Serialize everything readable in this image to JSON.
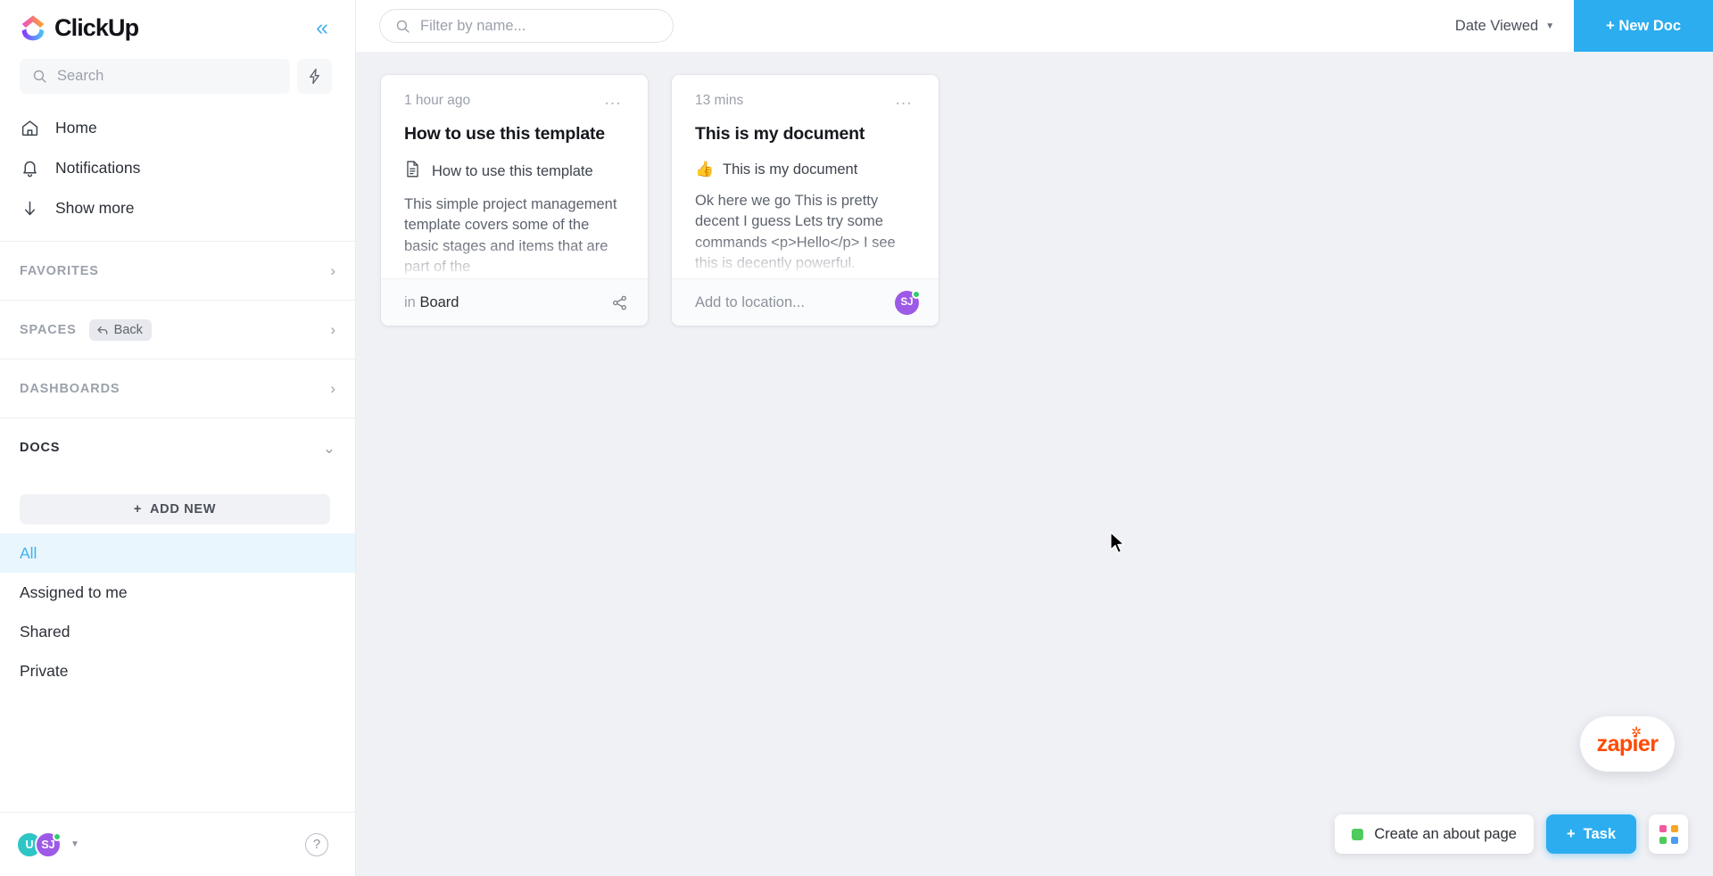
{
  "brand": {
    "name": "ClickUp",
    "collapse_icon": "chevrons-left-icon"
  },
  "sidebar": {
    "search": {
      "placeholder": "Search",
      "icon": "search-icon"
    },
    "bolt_icon": "lightning-bolt-icon",
    "nav": [
      {
        "label": "Home",
        "icon": "home-icon"
      },
      {
        "label": "Notifications",
        "icon": "bell-icon"
      },
      {
        "label": "Show more",
        "icon": "arrow-down-icon"
      }
    ],
    "sections": [
      {
        "label": "FAVORITES",
        "active": false,
        "chevron": "chevron-right-icon"
      },
      {
        "label": "SPACES",
        "active": false,
        "chevron": "chevron-right-icon",
        "back_label": "Back",
        "back_icon": "back-arrow-icon"
      },
      {
        "label": "DASHBOARDS",
        "active": false,
        "chevron": "chevron-right-icon"
      },
      {
        "label": "DOCS",
        "active": true,
        "chevron": "chevron-down-icon"
      }
    ],
    "add_new_label": "ADD NEW",
    "doc_filters": [
      {
        "label": "All",
        "selected": true
      },
      {
        "label": "Assigned to me",
        "selected": false
      },
      {
        "label": "Shared",
        "selected": false
      },
      {
        "label": "Private",
        "selected": false
      }
    ],
    "footer": {
      "avatar_1": "U",
      "avatar_2": "SJ",
      "caret_icon": "caret-down-icon",
      "help_label": "?"
    }
  },
  "topbar": {
    "filter": {
      "placeholder": "Filter by name...",
      "icon": "search-icon"
    },
    "sort_label": "Date Viewed",
    "sort_caret": "caret-down-icon",
    "new_doc_label": "+ New Doc",
    "accent_color": "#2cadf0"
  },
  "cards": [
    {
      "time": "1 hour ago",
      "title": "How to use this template",
      "sub_icon": "document-icon",
      "sub_label": "How to use this template",
      "text": "This simple project management template covers some of the basic stages and items that are part of the",
      "footer_prefix": "in",
      "footer_location": "Board",
      "footer_icon": "share-icon",
      "menu_icon": "more-options-icon"
    },
    {
      "time": "13 mins",
      "title": "This is my document",
      "sub_icon": "thumbs-up-emoji",
      "sub_emoji": "👍",
      "sub_label": "This is my document",
      "text": "Ok here we go This is pretty decent I guess Lets try some commands <p>Hello</p> I see this is decently powerful.",
      "footer_placeholder": "Add to location...",
      "footer_avatar": "SJ",
      "menu_icon": "more-options-icon"
    }
  ],
  "floating": {
    "zapier_label": "zapier",
    "about_label": "Create an about page",
    "task_label": "Task",
    "task_plus": "+",
    "apps_icon": "app-grid-icon",
    "apps_colors": [
      "#ef5ba1",
      "#f5a623",
      "#4ecb5c",
      "#4a9df0"
    ]
  }
}
